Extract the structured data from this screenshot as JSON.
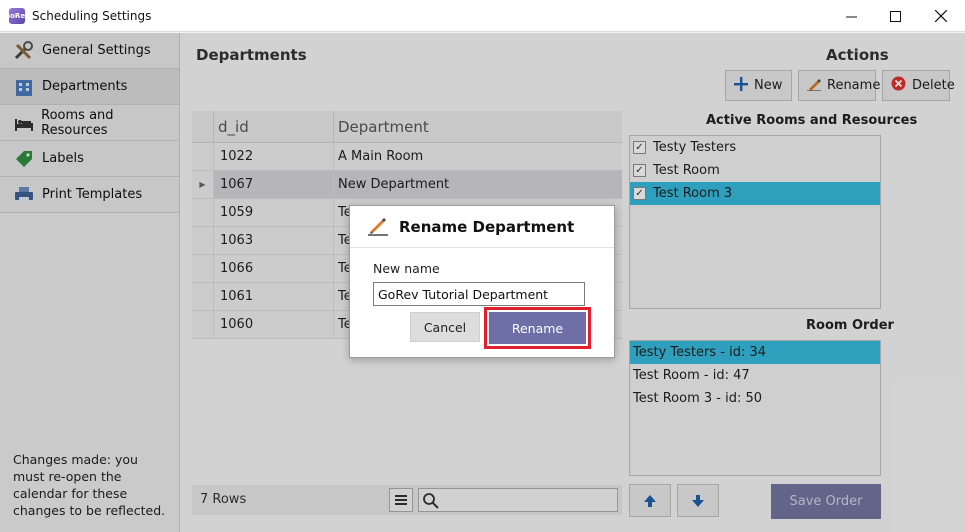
{
  "window": {
    "title": "Scheduling Settings",
    "app_badge": "GoRev"
  },
  "nav": {
    "items": [
      {
        "label": "General Settings",
        "icon": "tools-icon"
      },
      {
        "label": "Departments",
        "icon": "building-icon"
      },
      {
        "label": "Rooms and Resources",
        "icon": "bed-icon"
      },
      {
        "label": "Labels",
        "icon": "tag-icon"
      },
      {
        "label": "Print Templates",
        "icon": "printer-icon"
      }
    ],
    "note": "Changes made: you must re-open the calendar for these changes to be reflected."
  },
  "departments": {
    "title": "Departments",
    "columns": [
      "d_id",
      "Department"
    ],
    "rows": [
      {
        "id": "1022",
        "name": "A Main Room"
      },
      {
        "id": "1067",
        "name": "New Department"
      },
      {
        "id": "1059",
        "name": "Te"
      },
      {
        "id": "1063",
        "name": "Te"
      },
      {
        "id": "1066",
        "name": "Te"
      },
      {
        "id": "1061",
        "name": "Te"
      },
      {
        "id": "1060",
        "name": "Te"
      }
    ],
    "row_count": "7 Rows"
  },
  "actions": {
    "title": "Actions",
    "new_label": "New",
    "rename_label": "Rename",
    "delete_label": "Delete"
  },
  "active_rooms": {
    "title": "Active Rooms and Resources",
    "items": [
      "Testy Testers",
      "Test Room",
      "Test Room 3"
    ]
  },
  "room_order": {
    "title": "Room Order",
    "items": [
      "Testy Testers - id: 34",
      "Test Room - id: 47",
      "Test Room 3 - id: 50"
    ],
    "save_label": "Save Order"
  },
  "modal": {
    "title": "Rename Department",
    "field_label": "New name",
    "field_value": "GoRev Tutorial Department",
    "cancel_label": "Cancel",
    "rename_label": "Rename"
  },
  "colors": {
    "highlight": "#35b6d8",
    "primary_button": "#6d6fa6",
    "focus_outline": "#e0202c"
  }
}
